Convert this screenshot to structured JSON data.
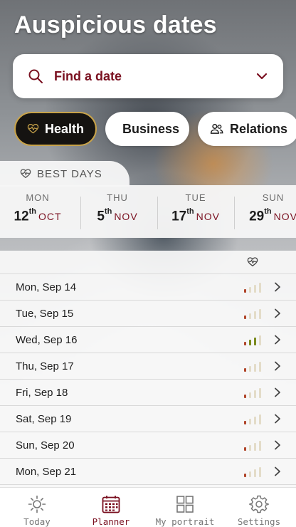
{
  "header": {
    "title": "Auspicious dates"
  },
  "search": {
    "label": "Find a date",
    "icon": "search-icon"
  },
  "categories": [
    {
      "label": "Health",
      "icon": "heart-pulse-icon",
      "active": true
    },
    {
      "label": "Business",
      "icon": "briefcase-icon",
      "active": false
    },
    {
      "label": "Relations",
      "icon": "people-icon",
      "active": false
    }
  ],
  "best_days": {
    "label": "BEST DAYS",
    "days": [
      {
        "dow": "MON",
        "day": "12",
        "suffix": "th",
        "month": "OCT"
      },
      {
        "dow": "THU",
        "day": "5",
        "suffix": "th",
        "month": "NOV"
      },
      {
        "dow": "TUE",
        "day": "17",
        "suffix": "th",
        "month": "NOV"
      },
      {
        "dow": "SUN",
        "day": "29",
        "suffix": "th",
        "month": "NOV"
      }
    ]
  },
  "dates": [
    {
      "label": "Mon, Sep 14",
      "level": 1
    },
    {
      "label": "Tue, Sep 15",
      "level": 1
    },
    {
      "label": "Wed, Sep 16",
      "level": 3
    },
    {
      "label": "Thu, Sep 17",
      "level": 1
    },
    {
      "label": "Fri, Sep 18",
      "level": 1
    },
    {
      "label": "Sat, Sep 19",
      "level": 1
    },
    {
      "label": "Sun, Sep 20",
      "level": 1
    },
    {
      "label": "Mon, Sep 21",
      "level": 1
    }
  ],
  "tabs": [
    {
      "label": "Today",
      "icon": "sun-icon",
      "active": false
    },
    {
      "label": "Planner",
      "icon": "calendar-icon",
      "active": true
    },
    {
      "label": "My portrait",
      "icon": "grid-icon",
      "active": false
    },
    {
      "label": "Settings",
      "icon": "gear-icon",
      "active": false
    }
  ],
  "colors": {
    "accent": "#7a1020",
    "gold": "#c8a34a",
    "bar_low": "#b0452a",
    "bar_mid": "#7a8a1e",
    "bar_empty": "#e3dcc8"
  }
}
